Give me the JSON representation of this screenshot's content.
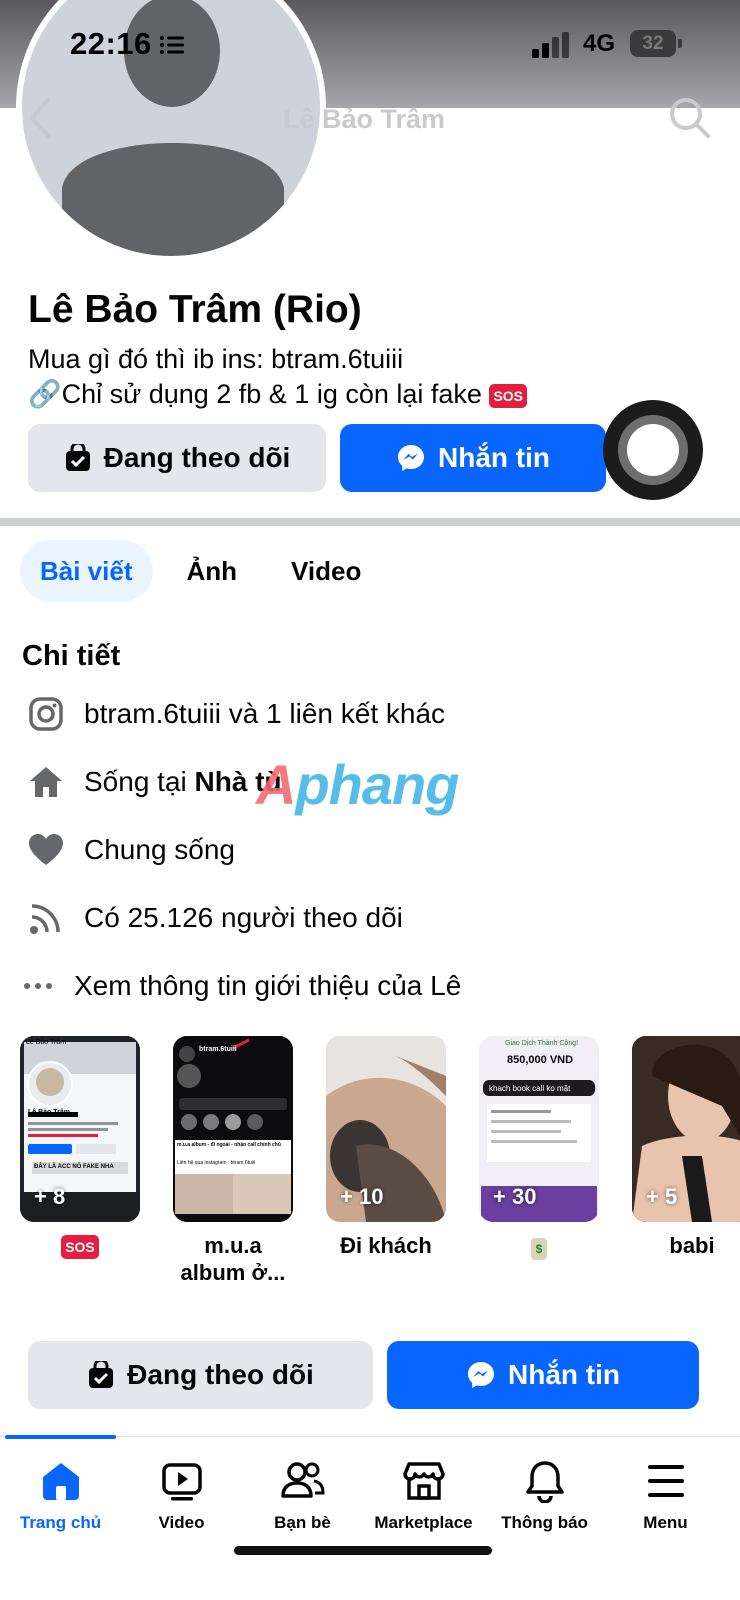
{
  "status_bar": {
    "time": "22:16",
    "network": "4G",
    "battery": "32"
  },
  "nav": {
    "title": "Lê Bảo Trâm"
  },
  "profile": {
    "name": "Lê Bảo Trâm (Rio)",
    "bio_line1": "Mua gì đó thì ib ins: btram.6tuiii",
    "bio_line2_prefix": "🔗Chỉ sử dụng 2 fb & 1 ig còn lại fake",
    "bio_line2_emoji": "SOS"
  },
  "actions": {
    "following_label": "Đang theo dõi",
    "message_label": "Nhắn tin"
  },
  "tabs": [
    {
      "label": "Bài viết",
      "active": true
    },
    {
      "label": "Ảnh",
      "active": false
    },
    {
      "label": "Video",
      "active": false
    }
  ],
  "details": {
    "title": "Chi tiết",
    "instagram": "btram.6tuiii và 1 liên kết khác",
    "lives_prefix": "Sống tại ",
    "lives_place": "Nhà tù",
    "relationship": "Chung sống",
    "followers": "Có 25.126 người theo dõi",
    "see_about": "Xem thông tin giới thiệu của Lê"
  },
  "watermark": {
    "part1": "A",
    "part2": "phang"
  },
  "highlights": [
    {
      "count": "+ 8",
      "label": "SOS",
      "label_type": "sos-emoji"
    },
    {
      "count": "",
      "label": "m.u.a album ở...",
      "label_type": "text"
    },
    {
      "count": "+ 10",
      "label": "Đi khách",
      "label_type": "text"
    },
    {
      "count": "+ 30",
      "label": "$",
      "label_type": "money-emoji"
    },
    {
      "count": "+ 5",
      "label": "babi",
      "label_type": "text"
    }
  ],
  "highlight_text": {
    "card1_header": "Lê Bảo Trâm",
    "card1_name": "Lê Bảo Trâm",
    "card1_banner": "ĐÂY LÀ ACC NÓ FAKE NHA",
    "card2_handle": "btram.6tuiii",
    "card2_banner": "m.u.a album - đi ngoài - nhận call chính chủ",
    "card2_sub": "Liên hệ qua instagram : btram.6tuiii",
    "card4_title": "Giao Dịch Thành Công!",
    "card4_amount": "850,000 VND",
    "card4_note": "khach book call ko mặt"
  },
  "tabbar": [
    {
      "label": "Trang chủ",
      "icon": "home-icon",
      "active": true
    },
    {
      "label": "Video",
      "icon": "video-icon",
      "active": false
    },
    {
      "label": "Bạn bè",
      "icon": "friends-icon",
      "active": false
    },
    {
      "label": "Marketplace",
      "icon": "marketplace-icon",
      "active": false
    },
    {
      "label": "Thông báo",
      "icon": "bell-icon",
      "active": false
    },
    {
      "label": "Menu",
      "icon": "menu-icon",
      "active": false
    }
  ],
  "colors": {
    "accent": "#0866ff",
    "button_gray": "#e4e6eb",
    "divider": "#ced0d4"
  }
}
